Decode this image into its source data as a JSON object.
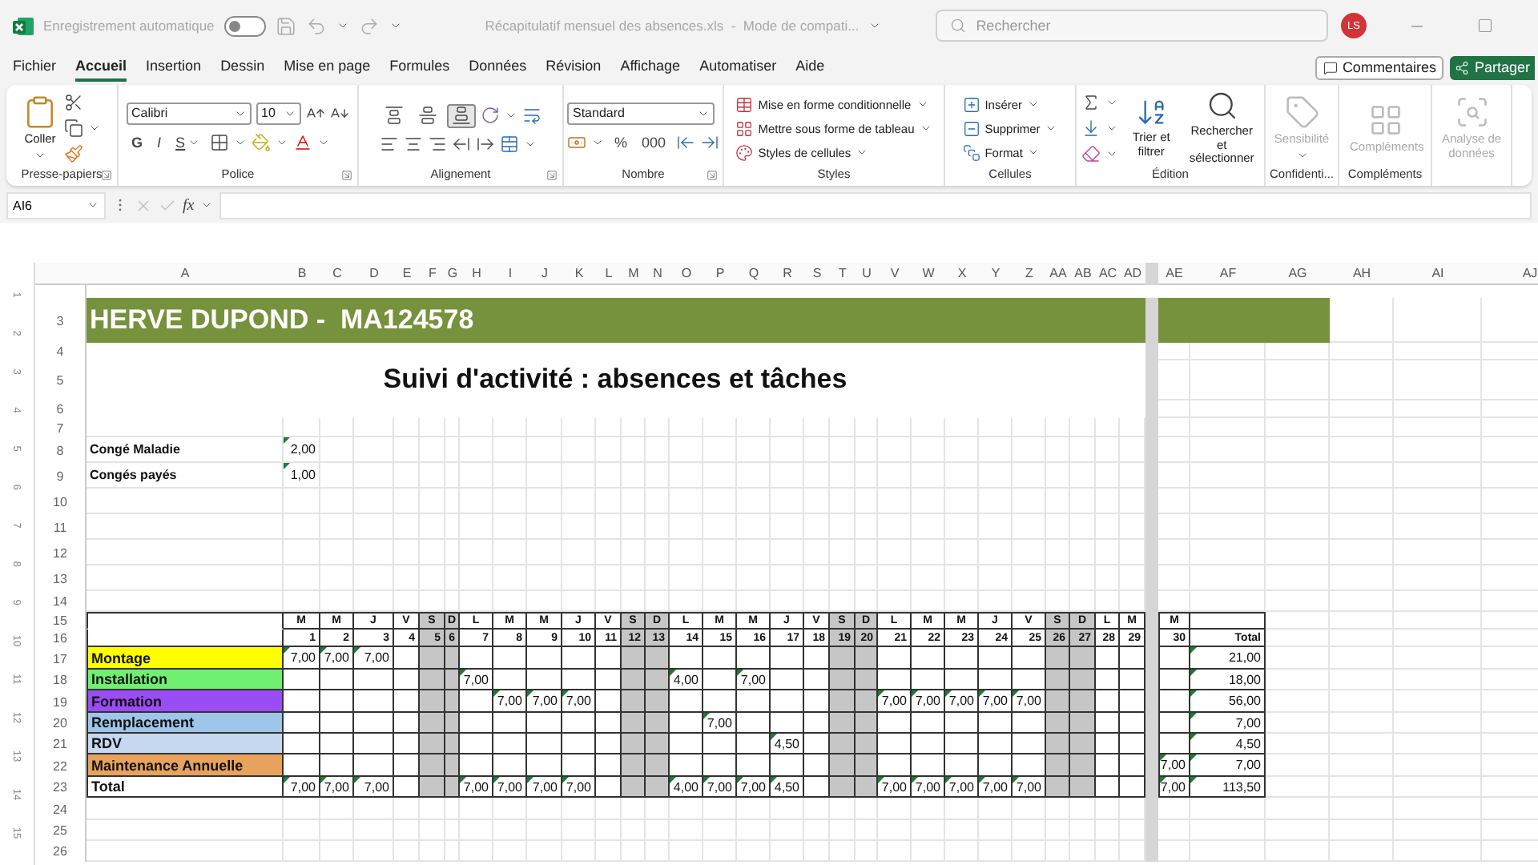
{
  "title_bar": {
    "autosave_label": "Enregistrement automatique",
    "autosave_on": false,
    "filename": "Récapitulatif mensuel des absences.xls  -  Mode de compati...",
    "search_placeholder": "Rechercher",
    "avatar": "LS"
  },
  "menu": {
    "tabs": [
      {
        "label": "Fichier",
        "selected": false
      },
      {
        "label": "Accueil",
        "selected": true
      },
      {
        "label": "Insertion",
        "selected": false
      },
      {
        "label": "Dessin",
        "selected": false
      },
      {
        "label": "Mise en page",
        "selected": false
      },
      {
        "label": "Formules",
        "selected": false
      },
      {
        "label": "Données",
        "selected": false
      },
      {
        "label": "Révision",
        "selected": false
      },
      {
        "label": "Affichage",
        "selected": false
      },
      {
        "label": "Automatiser",
        "selected": false
      },
      {
        "label": "Aide",
        "selected": false
      }
    ],
    "comments": "Commentaires",
    "share": "Partager"
  },
  "ribbon": {
    "groups": [
      {
        "label": "Presse-papiers",
        "items": [
          "Coller"
        ]
      },
      {
        "label": "Police",
        "items": [
          "Calibri",
          "10",
          "G",
          "I",
          "S"
        ]
      },
      {
        "label": "Alignement",
        "toggles": [
          {
            "selected": false
          },
          {
            "selected": false
          },
          {
            "selected": true
          }
        ]
      },
      {
        "label": "Nombre",
        "items": [
          "Standard",
          "%",
          "000"
        ]
      },
      {
        "label": "Styles",
        "items": [
          "Mise en forme conditionnelle",
          "Mettre sous forme de tableau",
          "Styles de cellules"
        ]
      },
      {
        "label": "Cellules",
        "items": [
          "Insérer",
          "Supprimer",
          "Format"
        ]
      },
      {
        "label": "Édition",
        "items": [
          "Trier et filtrer",
          "Rechercher et sélectionner"
        ]
      },
      {
        "label": "Confidenti...",
        "buttons": [
          {
            "label": "Sensibilité",
            "disabled": true
          }
        ]
      },
      {
        "label": "Compléments",
        "buttons": [
          {
            "label": "Compléments",
            "disabled": true
          }
        ]
      },
      {
        "buttons": [
          {
            "label": "Analyse de données",
            "disabled": true
          }
        ]
      }
    ]
  },
  "formula_bar": {
    "name_box": "AI6",
    "fx": "fx"
  },
  "columns": [
    "A",
    "B",
    "C",
    "D",
    "E",
    "F",
    "G",
    "H",
    "I",
    "J",
    "K",
    "L",
    "M",
    "N",
    "O",
    "P",
    "Q",
    "R",
    "S",
    "T",
    "U",
    "V",
    "W",
    "X",
    "Y",
    "Z",
    "AA",
    "AB",
    "AC",
    "AD",
    "AE",
    "AF",
    "AG",
    "AH",
    "AI",
    "AJ"
  ],
  "ruler": [
    "1",
    "2",
    "3",
    "4",
    "5",
    "6",
    "7",
    "8",
    "9",
    "10",
    "11",
    "12",
    "13",
    "14",
    "15"
  ],
  "row_numbers": [
    "3",
    "4",
    "5",
    "6",
    "7",
    "8",
    "9",
    "10",
    "11",
    "12",
    "13",
    "14",
    "15",
    "16",
    "17",
    "18",
    "19",
    "20",
    "21",
    "22",
    "23",
    "24",
    "25",
    "26"
  ],
  "sheet": {
    "banner": "HERVE DUPOND -  MA124578",
    "heading": "Suivi d'activité : absences et tâches",
    "summary": [
      {
        "label": "Congé Maladie",
        "value": "2,00"
      },
      {
        "label": "Congés payés",
        "value": "1,00"
      }
    ],
    "days": [
      {
        "letter": "M",
        "number": "1",
        "weekend": false
      },
      {
        "letter": "M",
        "number": "2",
        "weekend": false
      },
      {
        "letter": "J",
        "number": "3",
        "weekend": false
      },
      {
        "letter": "V",
        "number": "4",
        "weekend": false
      },
      {
        "letter": "S",
        "number": "5",
        "weekend": true
      },
      {
        "letter": "D",
        "number": "6",
        "weekend": true
      },
      {
        "letter": "L",
        "number": "7",
        "weekend": false
      },
      {
        "letter": "M",
        "number": "8",
        "weekend": false
      },
      {
        "letter": "M",
        "number": "9",
        "weekend": false
      },
      {
        "letter": "J",
        "number": "10",
        "weekend": false
      },
      {
        "letter": "V",
        "number": "11",
        "weekend": false
      },
      {
        "letter": "S",
        "number": "12",
        "weekend": true
      },
      {
        "letter": "D",
        "number": "13",
        "weekend": true
      },
      {
        "letter": "L",
        "number": "14",
        "weekend": false
      },
      {
        "letter": "M",
        "number": "15",
        "weekend": false
      },
      {
        "letter": "M",
        "number": "16",
        "weekend": false
      },
      {
        "letter": "J",
        "number": "17",
        "weekend": false
      },
      {
        "letter": "V",
        "number": "18",
        "weekend": false
      },
      {
        "letter": "S",
        "number": "19",
        "weekend": true
      },
      {
        "letter": "D",
        "number": "20",
        "weekend": true
      },
      {
        "letter": "L",
        "number": "21",
        "weekend": false
      },
      {
        "letter": "M",
        "number": "22",
        "weekend": false
      },
      {
        "letter": "M",
        "number": "23",
        "weekend": false
      },
      {
        "letter": "J",
        "number": "24",
        "weekend": false
      },
      {
        "letter": "V",
        "number": "25",
        "weekend": false
      },
      {
        "letter": "S",
        "number": "26",
        "weekend": true
      },
      {
        "letter": "D",
        "number": "27",
        "weekend": true
      },
      {
        "letter": "L",
        "number": "28",
        "weekend": false
      },
      {
        "letter": "M",
        "number": "29",
        "weekend": false
      },
      {
        "letter": "M",
        "number": "30",
        "weekend": false
      }
    ],
    "total_header": "Total",
    "tasks": [
      {
        "name": "Montage",
        "color": "#ffff00",
        "total": "21,00",
        "cells": [
          {
            "kind": "hours",
            "value": "7,00"
          },
          {
            "kind": "hours",
            "value": "7,00"
          },
          {
            "kind": "hours",
            "value": "7,00"
          },
          {
            "kind": "empty"
          },
          {
            "kind": "empty"
          },
          {
            "kind": "empty"
          },
          {
            "kind": "empty"
          },
          {
            "kind": "empty"
          },
          {
            "kind": "empty"
          },
          {
            "kind": "empty"
          },
          {
            "kind": "empty"
          },
          {
            "kind": "empty"
          },
          {
            "kind": "empty"
          },
          {
            "kind": "empty"
          },
          {
            "kind": "empty"
          },
          {
            "kind": "empty"
          },
          {
            "kind": "empty"
          },
          {
            "kind": "empty"
          },
          {
            "kind": "empty"
          },
          {
            "kind": "empty"
          },
          {
            "kind": "empty"
          },
          {
            "kind": "empty"
          },
          {
            "kind": "empty"
          },
          {
            "kind": "empty"
          },
          {
            "kind": "empty"
          },
          {
            "kind": "empty"
          },
          {
            "kind": "empty"
          },
          {
            "kind": "empty"
          },
          {
            "kind": "empty"
          },
          {
            "kind": "empty"
          }
        ]
      },
      {
        "name": "Installation",
        "color": "#70f070",
        "total": "18,00",
        "cells": [
          {
            "kind": "empty"
          },
          {
            "kind": "empty"
          },
          {
            "kind": "empty"
          },
          {
            "kind": "empty"
          },
          {
            "kind": "empty"
          },
          {
            "kind": "empty"
          },
          {
            "kind": "hours",
            "value": "7,00"
          },
          {
            "kind": "empty"
          },
          {
            "kind": "empty"
          },
          {
            "kind": "empty"
          },
          {
            "kind": "empty"
          },
          {
            "kind": "empty"
          },
          {
            "kind": "empty"
          },
          {
            "kind": "hours",
            "value": "4,00"
          },
          {
            "kind": "empty"
          },
          {
            "kind": "hours",
            "value": "7,00"
          },
          {
            "kind": "empty"
          },
          {
            "kind": "empty"
          },
          {
            "kind": "empty"
          },
          {
            "kind": "empty"
          },
          {
            "kind": "empty"
          },
          {
            "kind": "empty"
          },
          {
            "kind": "empty"
          },
          {
            "kind": "empty"
          },
          {
            "kind": "empty"
          },
          {
            "kind": "empty"
          },
          {
            "kind": "empty"
          },
          {
            "kind": "empty"
          },
          {
            "kind": "empty"
          },
          {
            "kind": "empty"
          }
        ]
      },
      {
        "name": "Formation",
        "color": "#9a4cf5",
        "total": "56,00",
        "cells": [
          {
            "kind": "empty"
          },
          {
            "kind": "empty"
          },
          {
            "kind": "empty"
          },
          {
            "kind": "empty"
          },
          {
            "kind": "empty"
          },
          {
            "kind": "empty"
          },
          {
            "kind": "empty"
          },
          {
            "kind": "hours",
            "value": "7,00"
          },
          {
            "kind": "hours",
            "value": "7,00"
          },
          {
            "kind": "hours",
            "value": "7,00"
          },
          {
            "kind": "empty"
          },
          {
            "kind": "empty"
          },
          {
            "kind": "empty"
          },
          {
            "kind": "empty"
          },
          {
            "kind": "empty"
          },
          {
            "kind": "empty"
          },
          {
            "kind": "empty"
          },
          {
            "kind": "empty"
          },
          {
            "kind": "empty"
          },
          {
            "kind": "empty"
          },
          {
            "kind": "hours",
            "value": "7,00"
          },
          {
            "kind": "hours",
            "value": "7,00"
          },
          {
            "kind": "hours",
            "value": "7,00"
          },
          {
            "kind": "hours",
            "value": "7,00"
          },
          {
            "kind": "hours",
            "value": "7,00"
          },
          {
            "kind": "empty"
          },
          {
            "kind": "empty"
          },
          {
            "kind": "empty"
          },
          {
            "kind": "empty"
          },
          {
            "kind": "empty"
          }
        ]
      },
      {
        "name": "Remplacement",
        "color": "#9fc5e8",
        "total": "7,00",
        "cells": [
          {
            "kind": "empty"
          },
          {
            "kind": "empty"
          },
          {
            "kind": "empty"
          },
          {
            "kind": "empty"
          },
          {
            "kind": "empty"
          },
          {
            "kind": "empty"
          },
          {
            "kind": "empty"
          },
          {
            "kind": "empty"
          },
          {
            "kind": "empty"
          },
          {
            "kind": "empty"
          },
          {
            "kind": "empty"
          },
          {
            "kind": "empty"
          },
          {
            "kind": "empty"
          },
          {
            "kind": "empty"
          },
          {
            "kind": "hours",
            "value": "7,00"
          },
          {
            "kind": "empty"
          },
          {
            "kind": "empty"
          },
          {
            "kind": "empty"
          },
          {
            "kind": "empty"
          },
          {
            "kind": "empty"
          },
          {
            "kind": "empty"
          },
          {
            "kind": "empty"
          },
          {
            "kind": "empty"
          },
          {
            "kind": "empty"
          },
          {
            "kind": "empty"
          },
          {
            "kind": "empty"
          },
          {
            "kind": "empty"
          },
          {
            "kind": "empty"
          },
          {
            "kind": "empty"
          },
          {
            "kind": "empty"
          }
        ]
      },
      {
        "name": "RDV",
        "color": "#c6d9f0",
        "total": "4,50",
        "cells": [
          {
            "kind": "empty"
          },
          {
            "kind": "empty"
          },
          {
            "kind": "empty"
          },
          {
            "kind": "empty"
          },
          {
            "kind": "empty"
          },
          {
            "kind": "empty"
          },
          {
            "kind": "empty"
          },
          {
            "kind": "empty"
          },
          {
            "kind": "empty"
          },
          {
            "kind": "empty"
          },
          {
            "kind": "empty"
          },
          {
            "kind": "empty"
          },
          {
            "kind": "empty"
          },
          {
            "kind": "empty"
          },
          {
            "kind": "empty"
          },
          {
            "kind": "empty"
          },
          {
            "kind": "hours",
            "value": "4,50"
          },
          {
            "kind": "empty"
          },
          {
            "kind": "empty"
          },
          {
            "kind": "empty"
          },
          {
            "kind": "empty"
          },
          {
            "kind": "empty"
          },
          {
            "kind": "empty"
          },
          {
            "kind": "empty"
          },
          {
            "kind": "empty"
          },
          {
            "kind": "empty"
          },
          {
            "kind": "empty"
          },
          {
            "kind": "empty"
          },
          {
            "kind": "empty"
          },
          {
            "kind": "empty"
          }
        ]
      },
      {
        "name": "Maintenance Annuelle",
        "color": "#e8a25c",
        "total": "7,00",
        "cells": [
          {
            "kind": "empty"
          },
          {
            "kind": "empty"
          },
          {
            "kind": "empty"
          },
          {
            "kind": "empty"
          },
          {
            "kind": "empty"
          },
          {
            "kind": "empty"
          },
          {
            "kind": "empty"
          },
          {
            "kind": "empty"
          },
          {
            "kind": "empty"
          },
          {
            "kind": "empty"
          },
          {
            "kind": "empty"
          },
          {
            "kind": "empty"
          },
          {
            "kind": "empty"
          },
          {
            "kind": "empty"
          },
          {
            "kind": "empty"
          },
          {
            "kind": "empty"
          },
          {
            "kind": "empty"
          },
          {
            "kind": "empty"
          },
          {
            "kind": "empty"
          },
          {
            "kind": "empty"
          },
          {
            "kind": "empty"
          },
          {
            "kind": "empty"
          },
          {
            "kind": "empty"
          },
          {
            "kind": "empty"
          },
          {
            "kind": "empty"
          },
          {
            "kind": "empty"
          },
          {
            "kind": "empty"
          },
          {
            "kind": "empty"
          },
          {
            "kind": "empty"
          },
          {
            "kind": "hours",
            "value": "7,00"
          }
        ]
      }
    ],
    "total_row": {
      "label": "Total",
      "total": "113,50",
      "cells": [
        {
          "kind": "hours",
          "value": "7,00"
        },
        {
          "kind": "hours",
          "value": "7,00"
        },
        {
          "kind": "hours",
          "value": "7,00"
        },
        {
          "kind": "empty"
        },
        {
          "kind": "empty"
        },
        {
          "kind": "empty"
        },
        {
          "kind": "hours",
          "value": "7,00"
        },
        {
          "kind": "hours",
          "value": "7,00"
        },
        {
          "kind": "hours",
          "value": "7,00"
        },
        {
          "kind": "hours",
          "value": "7,00"
        },
        {
          "kind": "empty"
        },
        {
          "kind": "empty"
        },
        {
          "kind": "empty"
        },
        {
          "kind": "hours",
          "value": "4,00"
        },
        {
          "kind": "hours",
          "value": "7,00"
        },
        {
          "kind": "hours",
          "value": "7,00"
        },
        {
          "kind": "hours",
          "value": "4,50"
        },
        {
          "kind": "empty"
        },
        {
          "kind": "empty"
        },
        {
          "kind": "empty"
        },
        {
          "kind": "hours",
          "value": "7,00"
        },
        {
          "kind": "hours",
          "value": "7,00"
        },
        {
          "kind": "hours",
          "value": "7,00"
        },
        {
          "kind": "hours",
          "value": "7,00"
        },
        {
          "kind": "hours",
          "value": "7,00"
        },
        {
          "kind": "empty"
        },
        {
          "kind": "empty"
        },
        {
          "kind": "empty"
        },
        {
          "kind": "empty"
        },
        {
          "kind": "hours",
          "value": "7,00"
        }
      ]
    }
  }
}
